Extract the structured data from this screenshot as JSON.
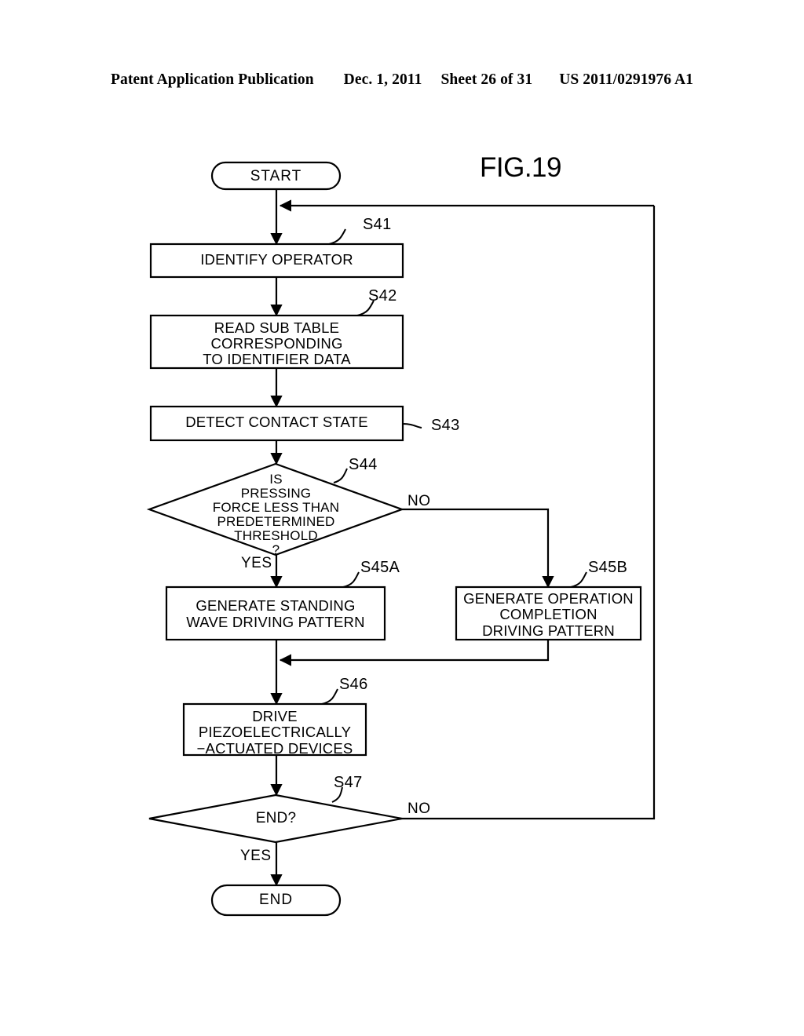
{
  "header": {
    "publication": "Patent Application Publication",
    "date": "Dec. 1, 2011",
    "sheet": "Sheet 26 of 31",
    "patent_number": "US 2011/0291976 A1"
  },
  "figure": {
    "title": "FIG.19"
  },
  "nodes": {
    "start": {
      "label": "START",
      "type": "terminal"
    },
    "s41": {
      "label": "IDENTIFY OPERATOR",
      "type": "process",
      "step": "S41"
    },
    "s42": {
      "label": "READ SUB TABLE\nCORRESPONDING\nTO IDENTIFIER DATA",
      "type": "process",
      "step": "S42"
    },
    "s43": {
      "label": "DETECT CONTACT STATE",
      "type": "process",
      "step": "S43"
    },
    "s44": {
      "label": "IS\nPRESSING\nFORCE LESS THAN\nPREDETERMINED\nTHRESHOLD\n?",
      "type": "decision",
      "step": "S44"
    },
    "s45a": {
      "label": "GENERATE STANDING\nWAVE DRIVING PATTERN",
      "type": "process",
      "step": "S45A"
    },
    "s45b": {
      "label": "GENERATE OPERATION\nCOMPLETION\nDRIVING PATTERN",
      "type": "process",
      "step": "S45B"
    },
    "s46": {
      "label": "DRIVE\nPIEZOELECTRICALLY\n−ACTUATED DEVICES",
      "type": "process",
      "step": "S46"
    },
    "s47": {
      "label": "END?",
      "type": "decision",
      "step": "S47"
    },
    "end": {
      "label": "END",
      "type": "terminal"
    }
  },
  "branches": {
    "s44_no": "NO",
    "s44_yes": "YES",
    "s47_no": "NO",
    "s47_yes": "YES"
  },
  "style": {
    "stroke": "#000000",
    "fill": "#ffffff",
    "background": "#ffffff"
  }
}
